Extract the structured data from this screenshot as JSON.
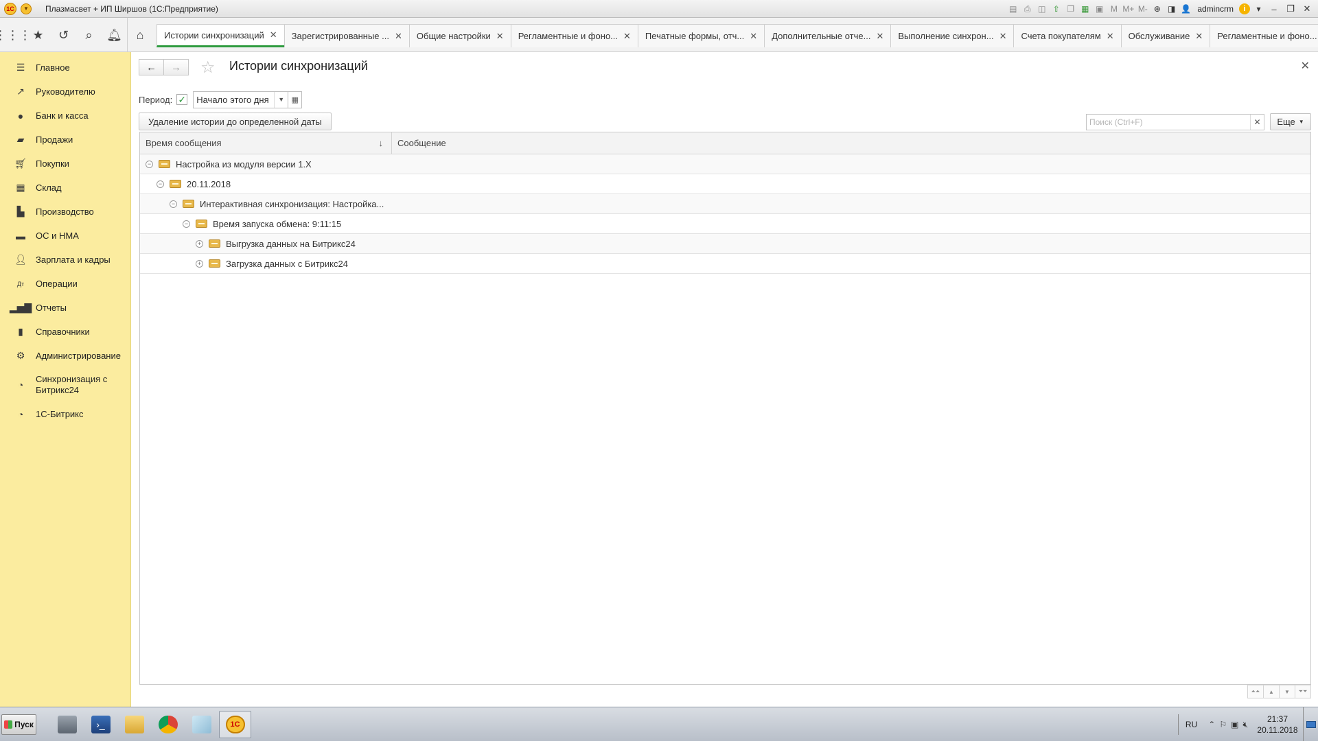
{
  "window": {
    "title": "Плазмасвет + ИП Ширшов  (1С:Предприятие)",
    "logo": "1С",
    "user": "admincrm",
    "toolbar_icons": [
      "save-icon",
      "print-icon",
      "preview-icon",
      "upload-icon",
      "copy-icon",
      "calendar-grid-icon",
      "calendar-icon",
      "m-icon",
      "m-plus-icon",
      "m-minus-icon",
      "zoom-icon",
      "panels-icon"
    ]
  },
  "toolbar": {
    "icons": [
      "apps-grid-icon",
      "favorites-star-icon",
      "history-icon",
      "search-icon",
      "bell-icon",
      "home-icon"
    ]
  },
  "tabs": [
    {
      "label": "Истории синхронизаций",
      "active": true
    },
    {
      "label": "Зарегистрированные ...",
      "active": false
    },
    {
      "label": "Общие настройки",
      "active": false
    },
    {
      "label": "Регламентные и фоно...",
      "active": false
    },
    {
      "label": "Печатные формы, отч...",
      "active": false
    },
    {
      "label": "Дополнительные отче...",
      "active": false
    },
    {
      "label": "Выполнение синхрон...",
      "active": false
    },
    {
      "label": "Счета покупателям",
      "active": false
    },
    {
      "label": "Обслуживание",
      "active": false
    },
    {
      "label": "Регламентные и фоно...",
      "active": false
    }
  ],
  "sidebar": {
    "items": [
      {
        "label": "Главное",
        "icon": "menu-lines-icon"
      },
      {
        "label": "Руководителю",
        "icon": "trend-icon"
      },
      {
        "label": "Банк и касса",
        "icon": "coin-icon"
      },
      {
        "label": "Продажи",
        "icon": "bag-icon"
      },
      {
        "label": "Покупки",
        "icon": "cart-icon"
      },
      {
        "label": "Склад",
        "icon": "warehouse-icon"
      },
      {
        "label": "Производство",
        "icon": "factory-icon"
      },
      {
        "label": "ОС и НМА",
        "icon": "truck-icon"
      },
      {
        "label": "Зарплата и кадры",
        "icon": "person-icon"
      },
      {
        "label": "Операции",
        "icon": "dt-kt-icon"
      },
      {
        "label": "Отчеты",
        "icon": "bar-chart-icon"
      },
      {
        "label": "Справочники",
        "icon": "book-icon"
      },
      {
        "label": "Администрирование",
        "icon": "gear-icon"
      },
      {
        "label": "Синхронизация с Битрикс24",
        "icon": "sync-icon"
      },
      {
        "label": "1С-Битрикс",
        "icon": "sync-icon"
      }
    ]
  },
  "page": {
    "title": "Истории синхронизаций",
    "period_label": "Период:",
    "period_checked": true,
    "period_value": "Начало этого дня",
    "delete_button": "Удаление истории до определенной даты",
    "search_placeholder": "Поиск (Ctrl+F)",
    "more_button": "Еще"
  },
  "table": {
    "columns": [
      "Время сообщения",
      "Сообщение"
    ],
    "sort_column": "Время сообщения",
    "sort_direction": "descending",
    "rows": [
      {
        "level": 0,
        "expanded": true,
        "text": "Настройка из модуля версии 1.X"
      },
      {
        "level": 1,
        "expanded": true,
        "text": "20.11.2018"
      },
      {
        "level": 2,
        "expanded": true,
        "text": "Интерактивная синхронизация: Настройка..."
      },
      {
        "level": 3,
        "expanded": true,
        "text": "Время запуска обмена: 9:11:15"
      },
      {
        "level": 4,
        "expanded": false,
        "text": "Выгрузка данных на Битрикс24"
      },
      {
        "level": 4,
        "expanded": false,
        "text": "Загрузка данных с Битрикс24"
      }
    ]
  },
  "taskbar": {
    "start_label": "Пуск",
    "apps": [
      "server-manager-icon",
      "powershell-icon",
      "explorer-icon",
      "chrome-icon",
      "notepad-icon",
      "1c-icon"
    ],
    "active_app": "1c-icon",
    "language": "RU",
    "time": "21:37",
    "date": "20.11.2018"
  },
  "colors": {
    "sidebar_bg": "#fbec9f",
    "active_tab_accent": "#2e9b3f",
    "folder": "#e8b84a"
  }
}
